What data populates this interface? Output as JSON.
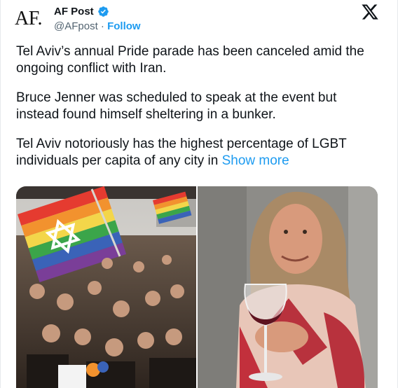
{
  "post": {
    "avatar_text": "AF.",
    "author_name": "AF Post",
    "handle": "@AFpost",
    "separator": "·",
    "follow_label": "Follow",
    "verified_icon": "verified-badge-icon",
    "paragraphs": [
      "Tel Aviv’s annual Pride parade has been canceled amid the ongoing conflict with Iran.",
      "Bruce Jenner was scheduled to speak at the event but instead found himself sheltering in a bunker.",
      "Tel Aviv notoriously has the highest percentage of LGBT individuals per capita of any city in "
    ],
    "show_more": "Show more"
  },
  "media": {
    "images": [
      {
        "description_icon": "pride-parade-photo"
      },
      {
        "description_icon": "woman-holding-wine-glass-photo"
      }
    ]
  },
  "colors": {
    "accent": "#1d9bf0",
    "text": "#0f1419",
    "muted": "#536471"
  }
}
